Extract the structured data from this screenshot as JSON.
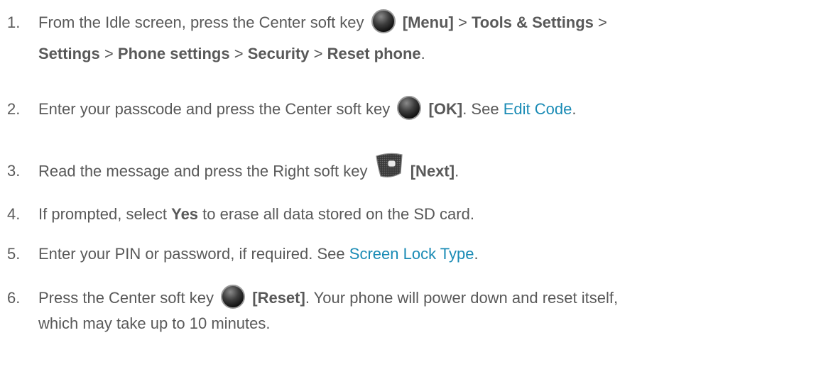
{
  "steps": [
    {
      "num": "1.",
      "t1": "From the Idle screen, press the Center soft key",
      "key_label": "[Menu]",
      "t2": ">",
      "b1": "Tools & Settings",
      "t3": ">",
      "b2": "Settings",
      "t4": ">",
      "b3": "Phone settings",
      "t5": ">",
      "b4": "Security",
      "t6": ">",
      "b5": "Reset phone",
      "t7": "."
    },
    {
      "num": "2.",
      "t1": "Enter your passcode and press the Center soft key",
      "key_label": "[OK]",
      "t2": ". See",
      "link": "Edit Code",
      "t3": "."
    },
    {
      "num": "3.",
      "t1": "Read the message and press the Right soft key",
      "key_label": "[Next]",
      "t2": "."
    },
    {
      "num": "4.",
      "t1": "If prompted, select",
      "b1": "Yes",
      "t2": "to erase all data stored on the SD card."
    },
    {
      "num": "5.",
      "t1": "Enter your PIN or password, if required. See",
      "link": "Screen Lock Type",
      "t2": "."
    },
    {
      "num": "6.",
      "t1": "Press the Center soft key",
      "key_label": "[Reset]",
      "t2": ". Your phone will power down and reset itself,",
      "t3": "which may take up to 10 minutes."
    }
  ],
  "colors": {
    "text": "#595959",
    "link": "#1a8bb5"
  },
  "icons": {
    "center_key": "center-soft-key-icon",
    "right_key": "right-soft-key-icon"
  }
}
